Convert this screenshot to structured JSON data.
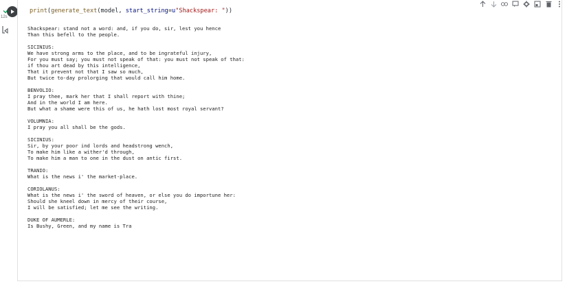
{
  "cell": {
    "exec_time": "12s",
    "code": {
      "fn": "print",
      "inner_fn": "generate_text",
      "arg1": "model",
      "kwarg": "start_string",
      "prefix": "u",
      "string": "\"Shackspear: \""
    },
    "toolbar": {
      "icons": [
        "arrow-up-icon",
        "arrow-down-icon",
        "link-icon",
        "comment-icon",
        "gear-icon",
        "mirror-icon",
        "delete-icon",
        "more-icon"
      ]
    }
  },
  "output": {
    "lines": [
      "Shackspear: stand not a word: and, if you do, sir, lest you hence",
      "Than this befell to the people.",
      "",
      "SICINIUS:",
      "We have strong arms to the place, and to be ingrateful injury,",
      "For you must say; you must not speak of that: you must not speak of that:",
      "if thou art dead by this intelligence,",
      "That it prevent not that I saw so much,",
      "But twice to-day prolorging that would call him home.",
      "",
      "BENVOLIO:",
      "I pray thee, mark her that I shall report with thine;",
      "And in the world I am here.",
      "But what a shame were this of us, he hath lost most royal servant?",
      "",
      "VOLUMNIA:",
      "I pray you all shall be the gods.",
      "",
      "SICINIUS:",
      "Sir, by your poor ind lords and headstrong wench,",
      "To make him like a wither'd through,",
      "To make him a man to one in the dust on antic first.",
      "",
      "TRANIO:",
      "What is the news i' the market-place.",
      "",
      "CORIOLANUS:",
      "What is the news i' the sword of heaven, or else you do importune her:",
      "Should she kneel down in mercy of their course,",
      "I will be satisfied; let me see the writing.",
      "",
      "DUKE OF AUMERLE:",
      "Is Bushy, Green, and my name is Tra"
    ]
  },
  "colors": {
    "check": "#0f9d58",
    "run_bg": "#3c4043",
    "fn": "#795e26",
    "string": "#a31515",
    "text": "#212121"
  }
}
